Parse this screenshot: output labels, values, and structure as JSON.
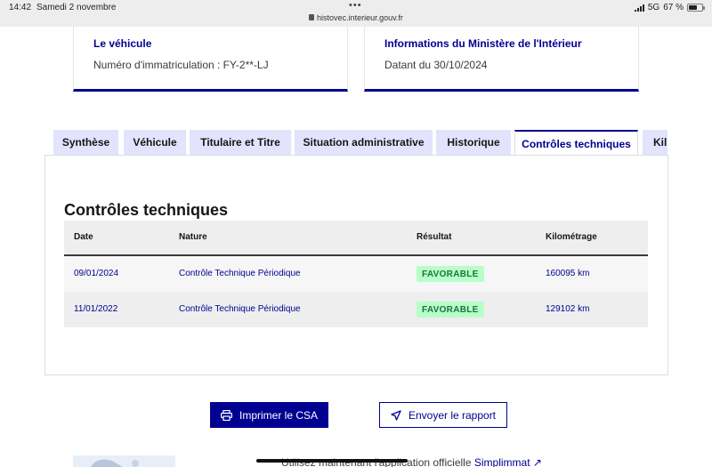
{
  "status_bar": {
    "time": "14:42",
    "date": "Samedi 2 novembre",
    "dots": "•••",
    "url": "histovec.interieur.gouv.fr",
    "network": "5G",
    "battery": "67 %",
    "battery_level": 0.67
  },
  "cards": {
    "vehicle": {
      "title": "Le véhicule",
      "text": "Numéro d'immatriculation : FY-2**-LJ"
    },
    "ministry": {
      "title": "Informations du Ministère de l'Intérieur",
      "text": "Datant du 30/10/2024"
    }
  },
  "tabs": [
    {
      "label": "Synthèse"
    },
    {
      "label": "Véhicule"
    },
    {
      "label": "Titulaire et Titre"
    },
    {
      "label": "Situation administrative"
    },
    {
      "label": "Historique"
    },
    {
      "label": "Contrôles techniques",
      "active": true
    },
    {
      "label": "Kil"
    }
  ],
  "section": {
    "title": "Contrôles techniques"
  },
  "table": {
    "headers": [
      "Date",
      "Nature",
      "Résultat",
      "Kilométrage"
    ],
    "rows": [
      {
        "date": "09/01/2024",
        "nature": "Contrôle Technique Périodique",
        "result": "FAVORABLE",
        "km": "160095 km"
      },
      {
        "date": "11/01/2022",
        "nature": "Contrôle Technique Périodique",
        "result": "FAVORABLE",
        "km": "129102 km"
      }
    ]
  },
  "buttons": {
    "print": "Imprimer le CSA",
    "send": "Envoyer le rapport"
  },
  "teaser": {
    "text": "Utilisez maintenant l'application officielle",
    "link": "Simplimmat"
  },
  "colors": {
    "accent": "#000091",
    "tab_bg": "#e3e3fd",
    "badge_bg": "#b8fec9",
    "badge_text": "#18753c"
  }
}
